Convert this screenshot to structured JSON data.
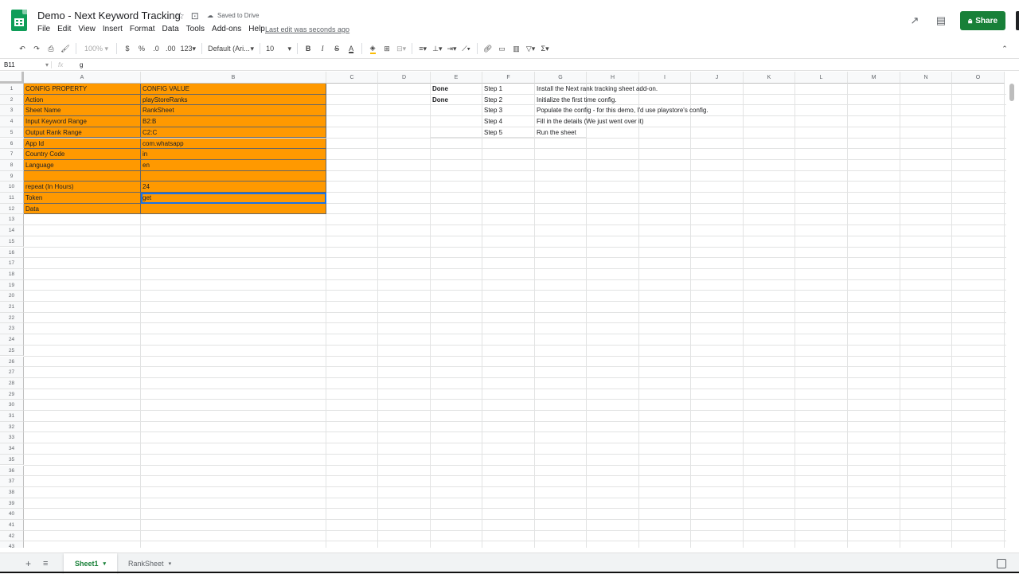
{
  "app": {
    "doc_title": "Demo - Next Keyword Tracking",
    "saved_status": "Saved to Drive",
    "last_edit": "Last edit was seconds ago",
    "share_label": "Share",
    "brand_color": "#0f9d58",
    "share_color": "#188038"
  },
  "menu": [
    "File",
    "Edit",
    "View",
    "Insert",
    "Format",
    "Data",
    "Tools",
    "Add-ons",
    "Help"
  ],
  "toolbar": {
    "zoom": "100%",
    "currency": "$",
    "percent": "%",
    "dec_decrease": ".0",
    "dec_increase": ".00",
    "format_more": "123",
    "font": "Default (Ari...",
    "font_size": "10",
    "bold": "B",
    "italic": "I",
    "strike": "S",
    "text_color_letter": "A",
    "sum": "Σ"
  },
  "formula": {
    "cell_ref": "B11",
    "fx": "fx",
    "value": "g"
  },
  "columns": [
    "A",
    "B",
    "C",
    "D",
    "E",
    "F",
    "G",
    "H",
    "I",
    "J",
    "K",
    "L",
    "M",
    "N",
    "O"
  ],
  "rows": [
    "1",
    "2",
    "3",
    "4",
    "5",
    "6",
    "7",
    "8",
    "9",
    "10",
    "11",
    "12",
    "13",
    "14",
    "15",
    "16",
    "17",
    "18",
    "19",
    "20",
    "21",
    "22",
    "23",
    "24",
    "25",
    "26",
    "27",
    "28",
    "29",
    "30",
    "31",
    "32",
    "33",
    "34",
    "35",
    "36",
    "37",
    "38",
    "39",
    "40",
    "41",
    "42",
    "43"
  ],
  "config": [
    {
      "property": "CONFIG PROPERTY",
      "value": "CONFIG VALUE"
    },
    {
      "property": "Action",
      "value": "playStoreRanks"
    },
    {
      "property": "Sheet Name",
      "value": "RankSheet"
    },
    {
      "property": "Input Keyword Range",
      "value": "B2:B"
    },
    {
      "property": "Output Rank Range",
      "value": "C2:C"
    },
    {
      "property": "App Id",
      "value": "com.whatsapp"
    },
    {
      "property": "Country Code",
      "value": "in"
    },
    {
      "property": "Language",
      "value": "en"
    },
    {
      "property": "",
      "value": ""
    },
    {
      "property": "repeat (In Hours)",
      "value": "24"
    },
    {
      "property": "Token",
      "value": "get"
    },
    {
      "property": "Data",
      "value": ""
    }
  ],
  "config_color": "#ff9900",
  "steps": [
    {
      "status": "Done",
      "step": "Step 1",
      "desc": "Install the Next rank tracking sheet add-on."
    },
    {
      "status": "Done",
      "step": "Step 2",
      "desc": "Initialize the first time config."
    },
    {
      "status": "",
      "step": "Step 3",
      "desc": "Populate the config - for this demo, I'd use playstore's config."
    },
    {
      "status": "",
      "step": "Step 4",
      "desc": "Fill in the details (We just went over it)"
    },
    {
      "status": "",
      "step": "Step 5",
      "desc": "Run the sheet"
    }
  ],
  "tabs": [
    {
      "label": "Sheet1",
      "active": true
    },
    {
      "label": "RankSheet",
      "active": false
    }
  ]
}
